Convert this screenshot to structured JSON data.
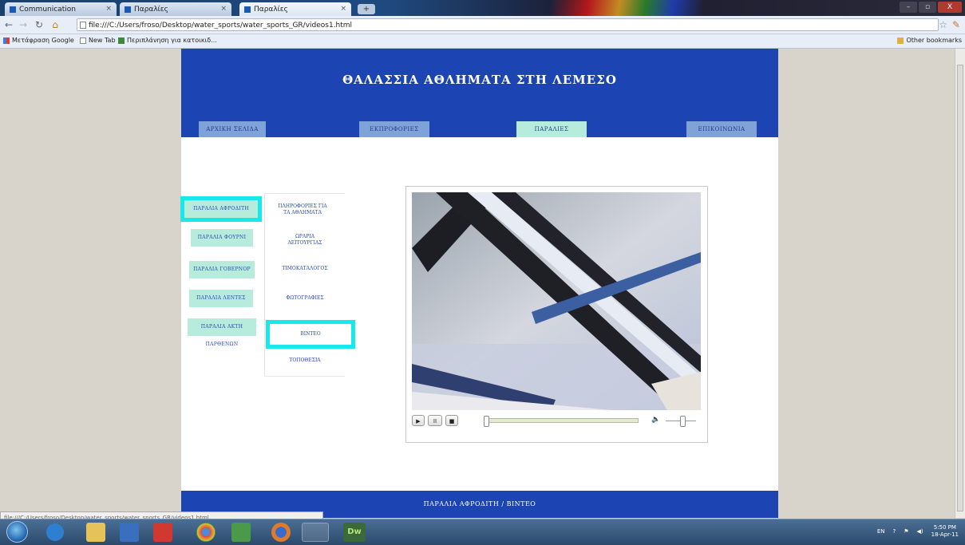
{
  "browser": {
    "tabs": [
      {
        "title": "Communication",
        "active": false
      },
      {
        "title": "Παραλίες",
        "active": false
      },
      {
        "title": "Παραλίες",
        "active": true
      }
    ],
    "url": "file:///C:/Users/froso/Desktop/water_sports/water_sports_GR/videos1.html",
    "bookmarks": [
      {
        "label": "Μετάφραση Google"
      },
      {
        "label": "New Tab"
      },
      {
        "label": "Περιπλάνηση για κατοικιδ..."
      }
    ],
    "other_bookmarks": "Other bookmarks",
    "status_url": "file:///C:/Users/froso/Desktop/water_sports/water_sports_GR/videos1.html"
  },
  "site": {
    "title": "ΘΑΛΑΣΣΙΑ ΑΘΛΗΜΑΤΑ ΣΤΗ ΛΕΜΕΣΟ",
    "nav": [
      {
        "label": "ΑΡΧΙΚΗ ΣΕΛΙΔΑ",
        "active": false
      },
      {
        "label": "ΕΚΠΡΟΦΟΡΙΕΣ",
        "active": false
      },
      {
        "label": "ΠΑΡΑΛΙΕΣ",
        "active": true
      },
      {
        "label": "ΕΠΙΚΟΙΝΩΝΙΑ",
        "active": false
      }
    ],
    "beaches": [
      {
        "label": "ΠΑΡΑΛΙΑ ΑΦΡΟΔΙΤΗ",
        "selected": true
      },
      {
        "label": "ΠΑΡΑΛΙΑ ΦΟΥΡΝΙ",
        "selected": false
      },
      {
        "label": "ΠΑΡΑΛΙΑ ΓΟΒΕΡΝΟΡ",
        "selected": false
      },
      {
        "label": "ΠΑΡΑΛΙΑ ΛΕΝΤΕΣ",
        "selected": false
      },
      {
        "label": "ΠΑΡΑΛΙΑ ΑΚΤΗ ΠΑΡΘΕΝΩΝ",
        "selected": false
      }
    ],
    "submenu": [
      {
        "label": "ΠΛΗΡΟΦΟΡΙΕΣ ΓΙΑ ΤΑ ΑΘΛΗΜΑΤΑ",
        "selected": false
      },
      {
        "label": "ΩΡΑΡΙΑ ΛΕΙΤΟΥΡΓΙΑΣ",
        "selected": false
      },
      {
        "label": "ΤΙΜΟΚΑΤΑΛΟΓΟΣ",
        "selected": false
      },
      {
        "label": "ΦΩΤΟΓΡΑΦΙΕΣ",
        "selected": false
      },
      {
        "label": "ΒΙΝΤΕΟ",
        "selected": true
      },
      {
        "label": "ΤΟΠΟΘΕΣΙΑ",
        "selected": false
      }
    ],
    "footer": "ΠΑΡΑΛΙΑ ΑΦΡΟΔΙΤΗ / ΒΙΝΤΕΟ",
    "player": {
      "progress": 0.0,
      "volume": 0.5
    }
  },
  "taskbar": {
    "apps": [
      "internet-explorer",
      "file-explorer",
      "media-player",
      "pdf-reader",
      "chrome",
      "network",
      "firefox",
      "word",
      "dreamweaver"
    ],
    "dw_label": "Dw",
    "lang": "EN",
    "time": "5:50 PM",
    "date": "18-Apr-11"
  },
  "colors": {
    "header_blue": "#1c45b3",
    "nav_blue": "#7fa3d8",
    "mint": "#b7ecdc",
    "cyan_highlight": "#16e8ec",
    "link_text": "#2a4ab0"
  }
}
